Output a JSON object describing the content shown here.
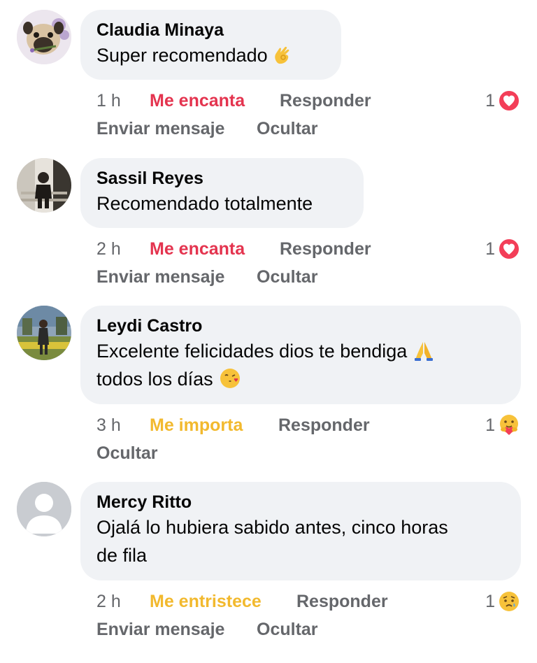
{
  "comments": [
    {
      "author": "Claudia Minaya",
      "lines": [
        "Super recomendado"
      ],
      "emoji": "ok-hand-emoji",
      "time": "1 h",
      "reaction_label": "Me encanta",
      "reply_label": "Responder",
      "reaction_count": "1",
      "reaction_icon": "love-reaction-icon",
      "secondary": [
        "Enviar mensaje",
        "Ocultar"
      ]
    },
    {
      "author": "Sassil Reyes",
      "lines": [
        "Recomendado totalmente"
      ],
      "time": "2 h",
      "reaction_label": "Me encanta",
      "reply_label": "Responder",
      "reaction_count": "1",
      "reaction_icon": "love-reaction-icon",
      "secondary": [
        "Enviar mensaje",
        "Ocultar"
      ]
    },
    {
      "author": "Leydi Castro",
      "lines": [
        "Excelente felicidades dios te bendiga",
        "todos los días"
      ],
      "emoji_line1": "praying-hands-emoji",
      "emoji_line2": "kissing-face-emoji",
      "time": "3 h",
      "reaction_label": "Me importa",
      "reply_label": "Responder",
      "reaction_count": "1",
      "reaction_icon": "care-reaction-icon",
      "secondary": [
        "Ocultar"
      ]
    },
    {
      "author": "Mercy Ritto",
      "lines": [
        "Ojalá lo hubiera sabido antes, cinco horas",
        "de fila"
      ],
      "time": "2 h",
      "reaction_label": "Me entristece",
      "reply_label": "Responder",
      "reaction_count": "1",
      "reaction_icon": "sad-reaction-icon",
      "secondary": [
        "Enviar mensaje",
        "Ocultar"
      ]
    }
  ],
  "colors": {
    "bubble": "#f0f2f5",
    "secondary_text": "#65676b",
    "love": "#e4344f",
    "care_sad": "#f2b92e"
  }
}
